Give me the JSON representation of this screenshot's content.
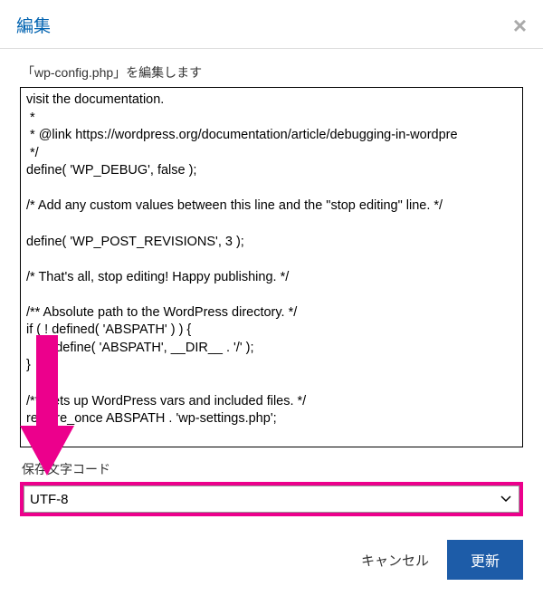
{
  "dialog": {
    "title": "編集",
    "subtitle": "「wp-config.php」を編集します",
    "code": "visit the documentation.\n *\n * @link https://wordpress.org/documentation/article/debugging-in-wordpre\n */\ndefine( 'WP_DEBUG', false );\n\n/* Add any custom values between this line and the \"stop editing\" line. */\n\ndefine( 'WP_POST_REVISIONS', 3 );\n\n/* That's all, stop editing! Happy publishing. */\n\n/** Absolute path to the WordPress directory. */\nif ( ! defined( 'ABSPATH' ) ) {\n        define( 'ABSPATH', __DIR__ . '/' );\n}\n\n/** Sets up WordPress vars and included files. */\nrequire_once ABSPATH . 'wp-settings.php';\n",
    "encoding_label": "保存文字コード",
    "encoding_value": "UTF-8",
    "cancel_label": "キャンセル",
    "submit_label": "更新"
  }
}
